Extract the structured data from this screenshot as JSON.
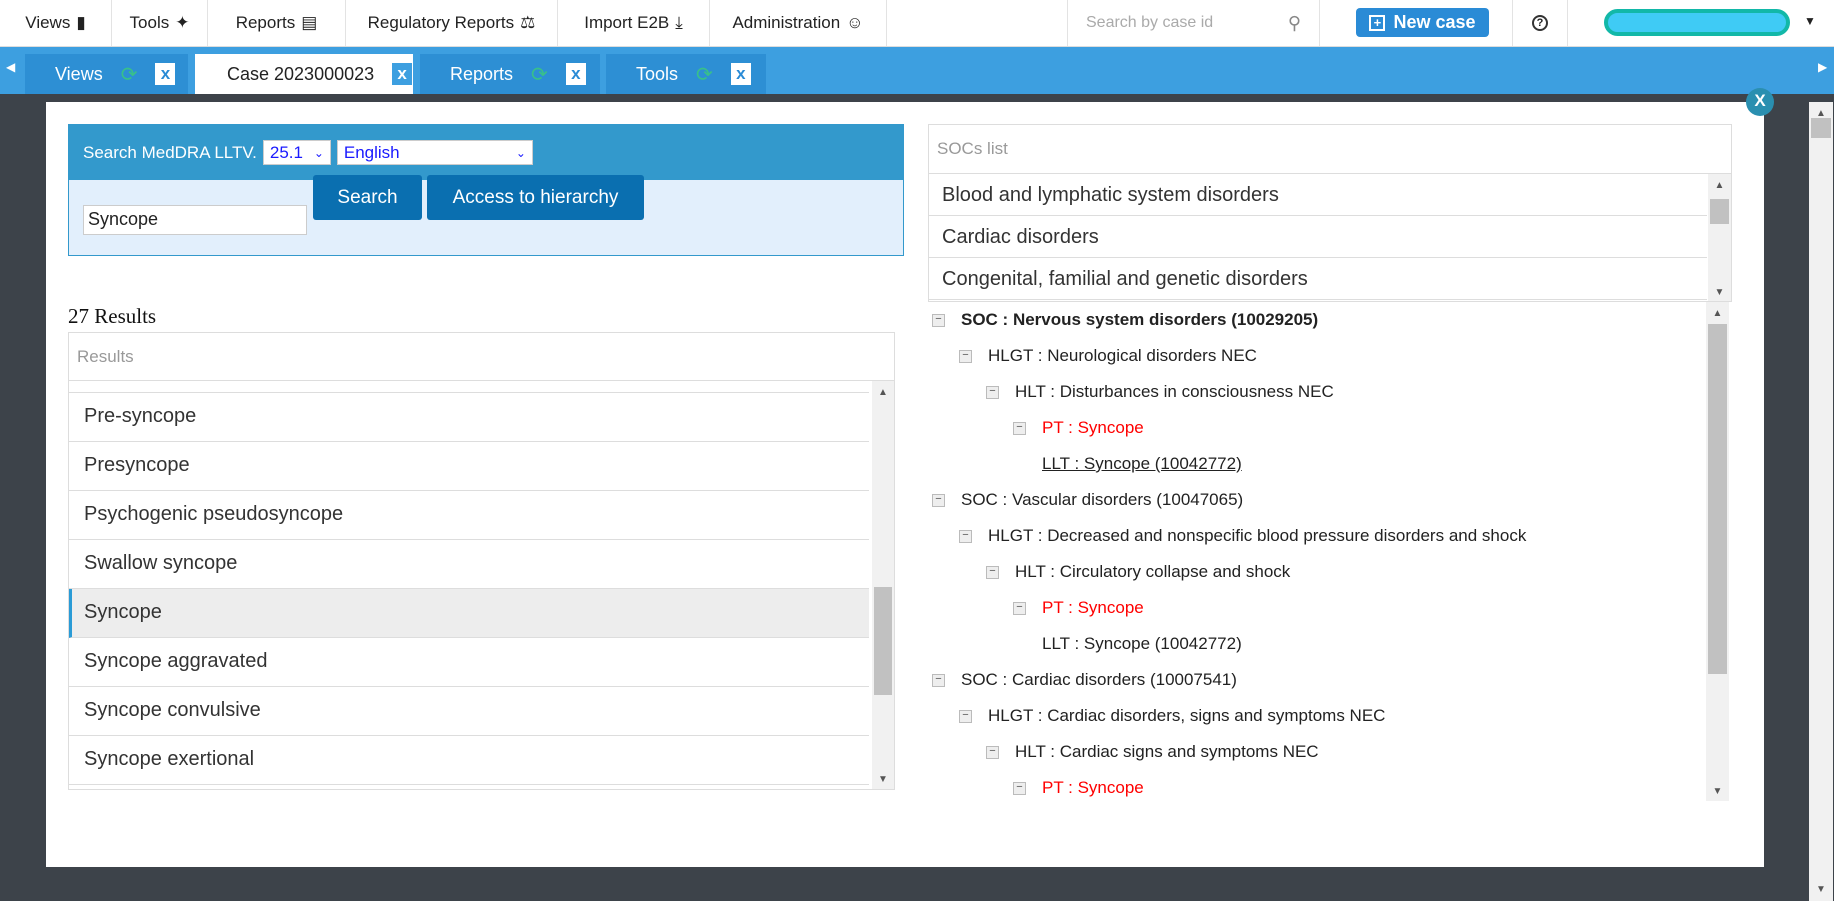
{
  "nav": {
    "items": [
      {
        "label": "Views",
        "icon": "book-icon"
      },
      {
        "label": "Tools",
        "icon": "magic-wand-icon"
      },
      {
        "label": "Reports",
        "icon": "bar-chart-icon"
      },
      {
        "label": "Regulatory Reports",
        "icon": "scale-icon"
      },
      {
        "label": "Import E2B",
        "icon": "download-icon"
      },
      {
        "label": "Administration",
        "icon": "user-icon"
      }
    ],
    "search_placeholder": "Search by case id",
    "new_case": "New case",
    "help": "?"
  },
  "tabs": [
    {
      "label": "Views"
    },
    {
      "label": "Case 2023000023",
      "active": true
    },
    {
      "label": "Reports"
    },
    {
      "label": "Tools"
    }
  ],
  "modal": {
    "close": "X",
    "search": {
      "title": "Search MedDRA LLTV.",
      "version": "25.1",
      "language": "English",
      "query": "Syncope",
      "search_btn": "Search",
      "hierarchy_btn": "Access to hierarchy"
    },
    "results": {
      "count_label": "27 Results",
      "header": "Results",
      "items": [
        "Pre-syncope",
        "Presyncope",
        "Psychogenic pseudosyncope",
        "Swallow syncope",
        "Syncope",
        "Syncope aggravated",
        "Syncope convulsive",
        "Syncope exertional"
      ],
      "selected": "Syncope"
    },
    "socs": {
      "header": "SOCs list",
      "items": [
        "Blood and lymphatic system disorders",
        "Cardiac disorders",
        "Congenital, familial and genetic disorders"
      ]
    },
    "tree": [
      {
        "level": 0,
        "text": "SOC : Nervous system disorders (10029205)",
        "bold": true
      },
      {
        "level": 1,
        "text": "HLGT : Neurological disorders NEC"
      },
      {
        "level": 2,
        "text": "HLT : Disturbances in consciousness NEC"
      },
      {
        "level": 3,
        "text": "PT : Syncope",
        "red": true
      },
      {
        "level": 4,
        "text": "LLT : Syncope (10042772)",
        "underline": true
      },
      {
        "level": 0,
        "text": "SOC : Vascular disorders (10047065)"
      },
      {
        "level": 1,
        "text": "HLGT : Decreased and nonspecific blood pressure disorders and shock"
      },
      {
        "level": 2,
        "text": "HLT : Circulatory collapse and shock"
      },
      {
        "level": 3,
        "text": "PT : Syncope",
        "red": true
      },
      {
        "level": 4,
        "text": "LLT : Syncope (10042772)"
      },
      {
        "level": 0,
        "text": "SOC : Cardiac disorders (10007541)"
      },
      {
        "level": 1,
        "text": "HLGT : Cardiac disorders, signs and symptoms NEC"
      },
      {
        "level": 2,
        "text": "HLT : Cardiac signs and symptoms NEC"
      },
      {
        "level": 3,
        "text": "PT : Syncope",
        "red": true
      }
    ]
  },
  "colors": {
    "accent": "#3d9fe0",
    "button": "#0a6fb0",
    "pt_red": "#ff0000"
  }
}
